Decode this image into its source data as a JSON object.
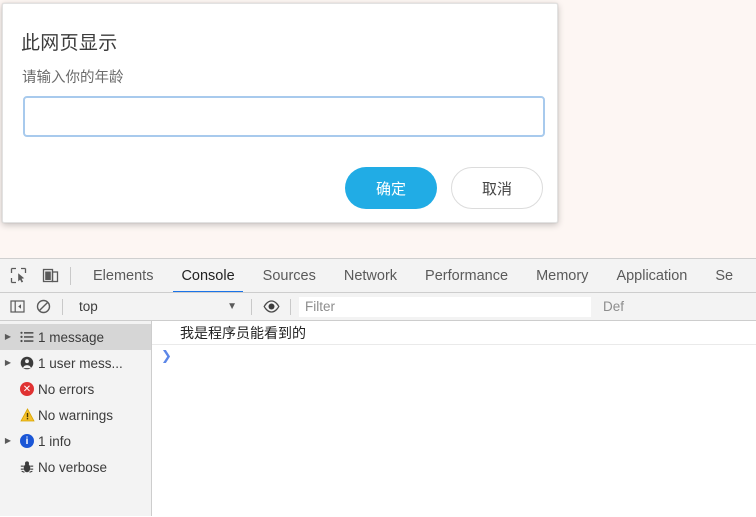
{
  "page": {
    "background_color": "#fdf6f3"
  },
  "dialog": {
    "title": "此网页显示",
    "message": "请输入你的年龄",
    "input_value": "",
    "input_placeholder": "",
    "confirm_label": "确定",
    "cancel_label": "取消",
    "accent_color": "#21ace5"
  },
  "devtools": {
    "toolbar_icons": [
      {
        "name": "inspect-element-icon"
      },
      {
        "name": "device-toolbar-icon"
      }
    ],
    "tabs": [
      {
        "label": "Elements",
        "active": false
      },
      {
        "label": "Console",
        "active": true
      },
      {
        "label": "Sources",
        "active": false
      },
      {
        "label": "Network",
        "active": false
      },
      {
        "label": "Performance",
        "active": false
      },
      {
        "label": "Memory",
        "active": false
      },
      {
        "label": "Application",
        "active": false
      },
      {
        "label": "Se",
        "active": false
      }
    ],
    "active_tab_color": "#1a73e8",
    "filterbar": {
      "sidebar_toggle_icon": "console-sidebar-toggle-icon",
      "clear_console_icon": "clear-console-icon",
      "context": "top",
      "chevron": "▼",
      "eye_icon": "live-expression-eye-icon",
      "filter_value": "",
      "filter_placeholder": "Filter",
      "levels_label": "Def"
    },
    "sidebar": [
      {
        "label": "1 message",
        "icon": "list-icon",
        "expandable": true,
        "selected": true
      },
      {
        "label": "1 user mess...",
        "icon": "user-message-icon",
        "expandable": true,
        "selected": false
      },
      {
        "label": "No errors",
        "icon": "error-icon",
        "expandable": false,
        "selected": false
      },
      {
        "label": "No warnings",
        "icon": "warning-icon",
        "expandable": false,
        "selected": false
      },
      {
        "label": "1 info",
        "icon": "info-icon",
        "expandable": true,
        "selected": false
      },
      {
        "label": "No verbose",
        "icon": "verbose-bug-icon",
        "expandable": false,
        "selected": false
      }
    ],
    "console": {
      "messages": [
        {
          "text": "我是程序员能看到的"
        }
      ],
      "prompt_symbol": "❯"
    }
  }
}
